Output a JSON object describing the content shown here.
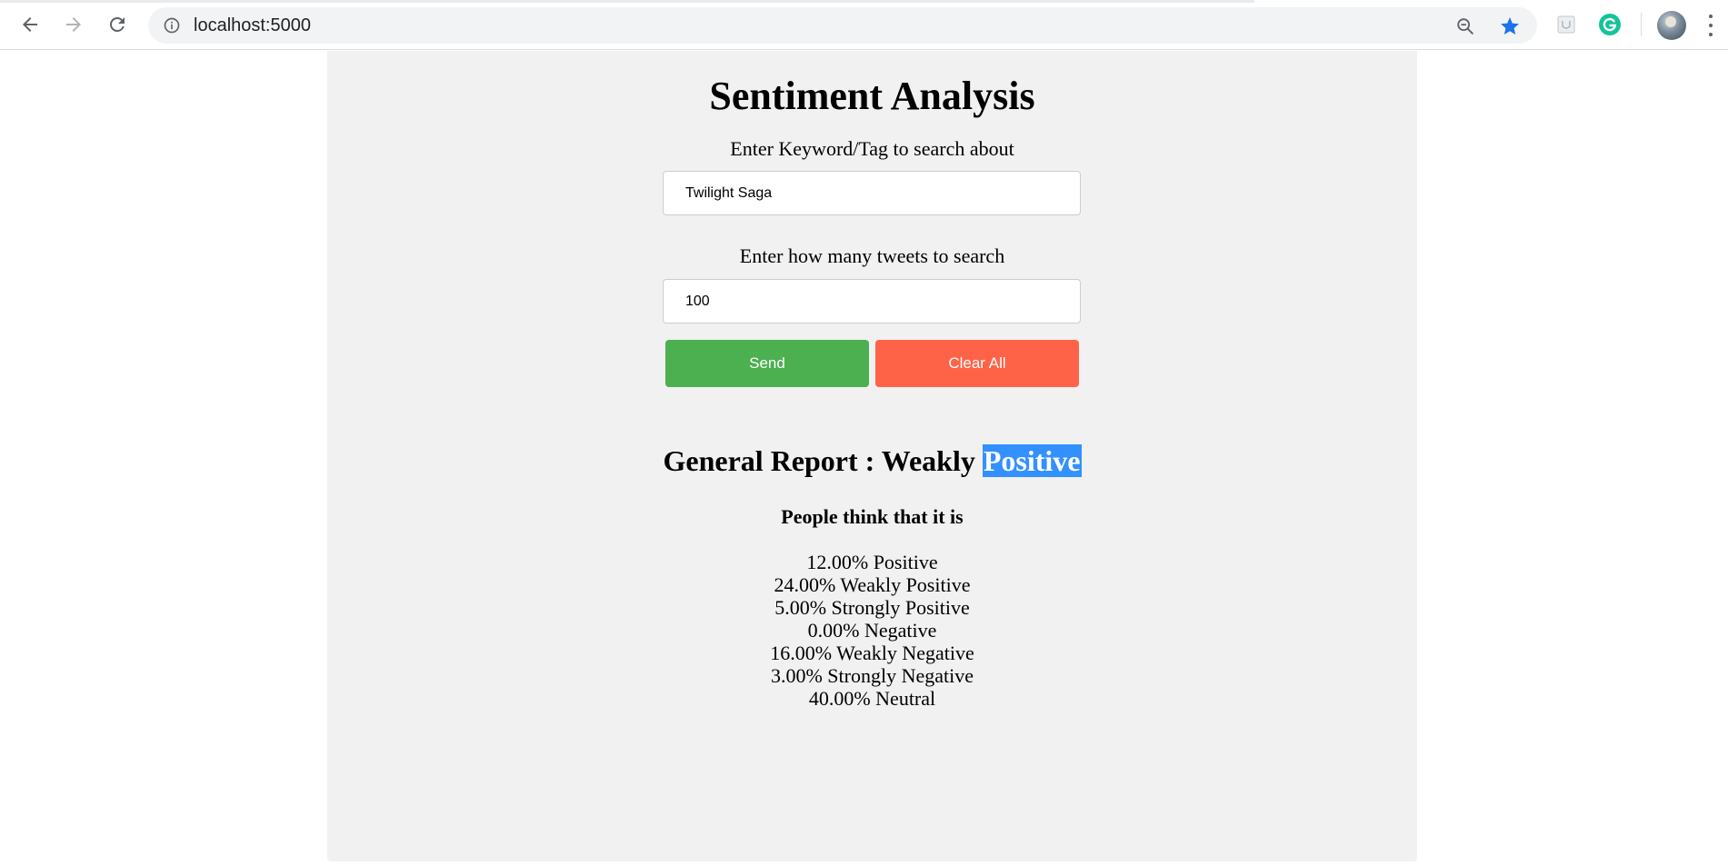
{
  "browser": {
    "url": "localhost:5000",
    "icons": {
      "back": "back-arrow-icon",
      "forward": "forward-arrow-icon",
      "reload": "reload-icon",
      "site_info": "info-icon",
      "zoom": "zoom-out-icon",
      "bookmark": "star-icon",
      "extension": "extension-icon",
      "grammarly": "grammarly-icon",
      "profile": "avatar",
      "menu": "kebab-menu-icon"
    }
  },
  "page": {
    "title": "Sentiment Analysis",
    "keyword_label": "Enter Keyword/Tag to search about",
    "keyword_value": "Twilight Saga",
    "count_label": "Enter how many tweets to search",
    "count_value": "100",
    "send_label": "Send",
    "clear_label": "Clear All",
    "report_prefix": "General Report : Weakly",
    "report_highlight": "Positive",
    "people_heading": "People think that it is",
    "stats": [
      "12.00% Positive",
      "24.00% Weakly Positive",
      "5.00% Strongly Positive",
      "0.00% Negative",
      "16.00% Weakly Negative",
      "3.00% Strongly Negative",
      "40.00% Neutral"
    ]
  },
  "colors": {
    "panel_bg": "#f1f1f1",
    "send_button": "#4caf50",
    "clear_button": "#ff6347",
    "selection_highlight": "#3390ff",
    "bookmark_star": "#1a73e8",
    "grammarly": "#15c39a"
  }
}
